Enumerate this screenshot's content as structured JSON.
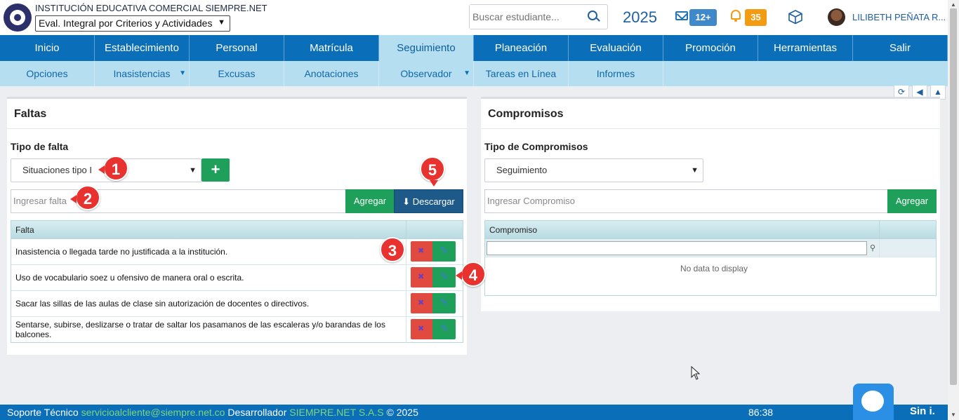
{
  "header": {
    "institution": "INSTITUCIÓN EDUCATIVA COMERCIAL SIEMPRE.NET",
    "eval_mode": "Eval. Integral por Criterios y Actividades",
    "search_placeholder": "Buscar estudiante...",
    "year": "2025",
    "mail_count": "12+",
    "notif_count": "35",
    "user_name": "LILIBETH PEÑATA R..."
  },
  "main_nav": [
    "Inicio",
    "Establecimiento",
    "Personal",
    "Matrícula",
    "Seguimiento",
    "Planeación",
    "Evaluación",
    "Promoción",
    "Herramientas",
    "Salir"
  ],
  "sub_nav": [
    "Opciones",
    "Inasistencias",
    "Excusas",
    "Anotaciones",
    "Observador",
    "Tareas en Línea",
    "Informes"
  ],
  "faltas": {
    "title": "Faltas",
    "tipo_label": "Tipo de falta",
    "tipo_value": "Situaciones tipo I",
    "input_placeholder": "Ingresar falta",
    "agregar_label": "Agregar",
    "descargar_label": "Descargar",
    "column": "Falta",
    "rows": [
      "Inasistencia o llegada tarde no justificada a la institución.",
      "Uso de vocabulario soez u ofensivo de manera oral o escrita.",
      "Sacar las sillas de las aulas de clase sin autorización de docentes o directivos.",
      "Sentarse, subirse, deslizarse o tratar de saltar los pasamanos de las escaleras y/o barandas de los balcones."
    ]
  },
  "compromisos": {
    "title": "Compromisos",
    "tipo_label": "Tipo de Compromisos",
    "tipo_value": "Seguimiento",
    "input_placeholder": "Ingresar Compromiso",
    "agregar_label": "Agregar",
    "column": "Compromiso",
    "empty": "No data to display"
  },
  "callouts": [
    "1",
    "2",
    "3",
    "4",
    "5"
  ],
  "footer": {
    "soporte": "Soporte Técnico",
    "email": "servicioalcliente@siempre.net.co",
    "dev_label": "Desarrollador",
    "dev_name": "SIEMPRE.NET S.A.S",
    "copyright": "© 2025",
    "timer": "86:38",
    "brand": "Sin i."
  },
  "colors": {
    "primary": "#0b6eb8",
    "subnav": "#b5dff0",
    "success": "#1fa05a",
    "danger": "#e04a3f",
    "dark_blue": "#1d5a8a",
    "callout": "#e8322f",
    "warning": "#f39c12"
  }
}
